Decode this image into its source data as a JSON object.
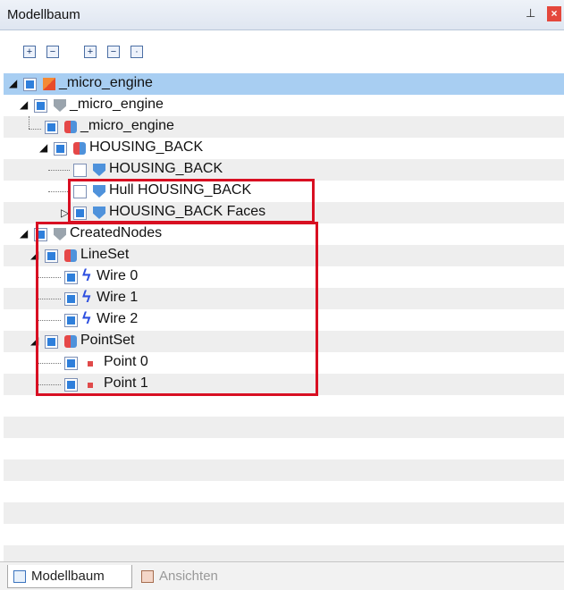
{
  "panel": {
    "title": "Modellbaum",
    "pin_icon": "pin-icon",
    "close_icon": "close-icon"
  },
  "toolbar": {
    "buttons": [
      "expand-all-icon",
      "collapse-all-icon",
      "expand-icon",
      "collapse-icon",
      "toggle-icon"
    ]
  },
  "tree": {
    "items": [
      {
        "label": "_micro_engine",
        "icon": "document-icon",
        "checked": true,
        "selected": true
      },
      {
        "label": "_micro_engine",
        "icon": "shield-icon",
        "checked": true
      },
      {
        "label": "_micro_engine",
        "icon": "part-icon",
        "checked": true
      },
      {
        "label": "HOUSING_BACK",
        "icon": "part-icon",
        "checked": true
      },
      {
        "label": "HOUSING_BACK",
        "icon": "shield-icon",
        "checked": false
      },
      {
        "label": "Hull HOUSING_BACK",
        "icon": "shield-icon",
        "checked": false
      },
      {
        "label": "HOUSING_BACK Faces",
        "icon": "shield-icon",
        "checked": true
      },
      {
        "label": "CreatedNodes",
        "icon": "shield-icon",
        "checked": true
      },
      {
        "label": "LineSet",
        "icon": "part-icon",
        "checked": true
      },
      {
        "label": "Wire 0",
        "icon": "wire-icon",
        "checked": true
      },
      {
        "label": "Wire 1",
        "icon": "wire-icon",
        "checked": true
      },
      {
        "label": "Wire 2",
        "icon": "wire-icon",
        "checked": true
      },
      {
        "label": "PointSet",
        "icon": "part-icon",
        "checked": true
      },
      {
        "label": "Point 0",
        "icon": "point-icon",
        "checked": true
      },
      {
        "label": "Point 1",
        "icon": "point-icon",
        "checked": true
      }
    ]
  },
  "tabs": [
    {
      "label": "Modellbaum",
      "active": true
    },
    {
      "label": "Ansichten",
      "active": false
    }
  ]
}
